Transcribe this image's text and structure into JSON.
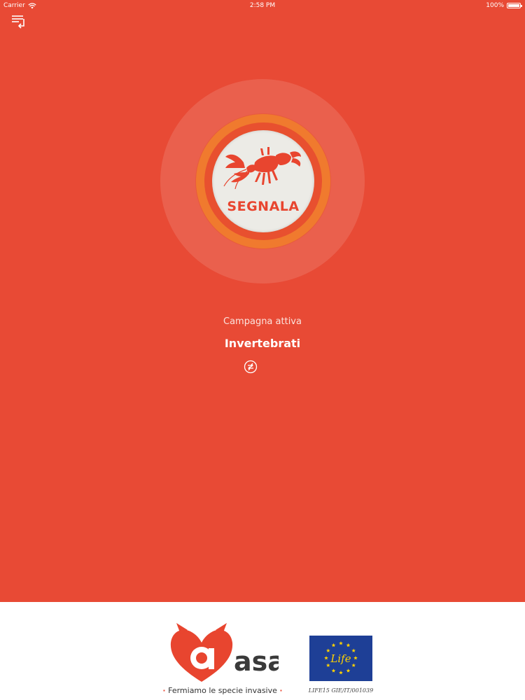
{
  "status_bar": {
    "carrier": "Carrier",
    "time": "2:58 PM",
    "battery": "100%",
    "battery_level": 1.0
  },
  "header": {
    "menu_icon": "menu-list-icon"
  },
  "report": {
    "label": "SEGNALA",
    "icon": "lobster-icon"
  },
  "campaign": {
    "caption": "Campagna attiva",
    "name": "Invertebrati",
    "switch_icon": "switch-campaign-icon"
  },
  "footer": {
    "logo_text": "asap",
    "slogan_separator": "·",
    "slogan": "Fermiamo le specie invasive",
    "eu_logo_text": "Life",
    "life_code": "LIFE15 GIE/IT/001039"
  },
  "colors": {
    "background": "#e84a35",
    "ring": "#f07a2e",
    "button": "#ecebe6",
    "footer": "#ffffff",
    "eu_blue": "#1e3f96",
    "eu_yellow": "#ffd200"
  }
}
